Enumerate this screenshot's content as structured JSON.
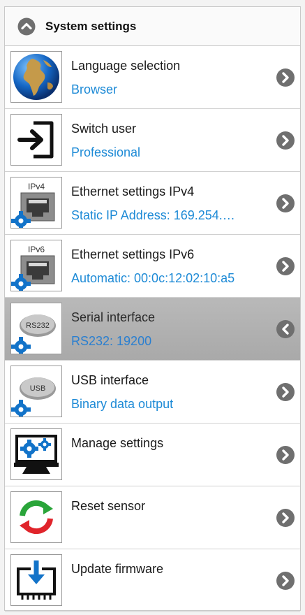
{
  "header": {
    "title": "System settings",
    "icon": "chevron-up-icon"
  },
  "items": [
    {
      "title": "Language selection",
      "subtitle": "Browser",
      "icon": "globe-icon",
      "nav": "chevron-right-icon",
      "selected": false
    },
    {
      "title": "Switch user",
      "subtitle": "Professional",
      "icon": "login-icon",
      "nav": "chevron-right-icon",
      "selected": false
    },
    {
      "title": "Ethernet settings IPv4",
      "subtitle": "Static IP Address: 169.254.…",
      "icon": "ethernet-port-icon",
      "icon_label": "IPv4",
      "nav": "chevron-right-icon",
      "selected": false
    },
    {
      "title": "Ethernet settings IPv6",
      "subtitle": "Automatic: 00:0c:12:02:10:a5",
      "icon": "ethernet-port-icon",
      "icon_label": "IPv6",
      "nav": "chevron-right-icon",
      "selected": false
    },
    {
      "title": "Serial interface",
      "subtitle": "RS232: 19200",
      "icon": "serial-port-icon",
      "icon_label": "RS232",
      "nav": "chevron-left-icon",
      "selected": true
    },
    {
      "title": "USB interface",
      "subtitle": "Binary data output",
      "icon": "usb-port-icon",
      "icon_label": "USB",
      "nav": "chevron-right-icon",
      "selected": false
    },
    {
      "title": "Manage settings",
      "subtitle": "",
      "icon": "monitor-gears-icon",
      "nav": "chevron-right-icon",
      "selected": false
    },
    {
      "title": "Reset sensor",
      "subtitle": "",
      "icon": "refresh-icon",
      "nav": "chevron-right-icon",
      "selected": false
    },
    {
      "title": "Update firmware",
      "subtitle": "",
      "icon": "firmware-download-icon",
      "nav": "chevron-right-icon",
      "selected": false
    }
  ],
  "colors": {
    "accent": "#1d8ad6",
    "nav_button": "#6f6f6f",
    "gear_blue": "#1273c9",
    "selected_bg": "#b1b1b1"
  }
}
